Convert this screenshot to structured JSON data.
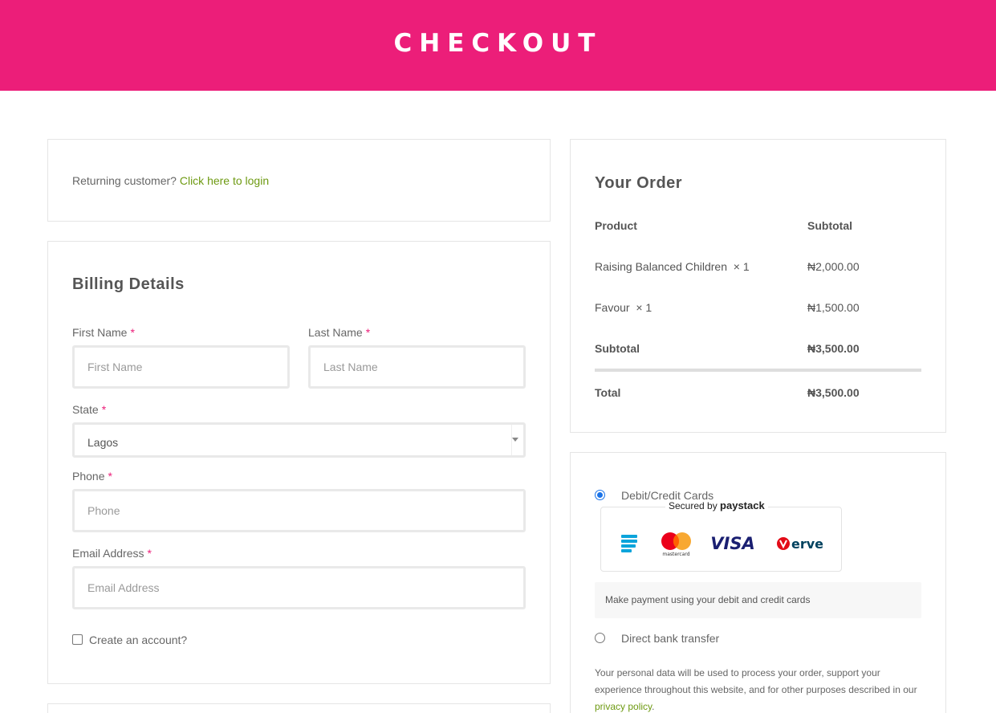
{
  "header": {
    "title": "CHECKOUT"
  },
  "login_notice": {
    "text": "Returning customer?",
    "link": "Click here to login"
  },
  "billing": {
    "heading": "Billing Details",
    "required_mark": "*",
    "first_name": {
      "label": "First Name",
      "placeholder": "First Name"
    },
    "last_name": {
      "label": "Last Name",
      "placeholder": "Last Name"
    },
    "state": {
      "label": "State",
      "value": "Lagos"
    },
    "phone": {
      "label": "Phone",
      "placeholder": "Phone"
    },
    "email": {
      "label": "Email Address",
      "placeholder": "Email Address"
    },
    "create_account": {
      "label": "Create an account?",
      "checked": false
    }
  },
  "order": {
    "heading": "Your Order",
    "col_product": "Product",
    "col_subtotal": "Subtotal",
    "items": [
      {
        "name": "Raising Balanced Children",
        "qty": "× 1",
        "price": "₦2,000.00"
      },
      {
        "name": "Favour",
        "qty": "× 1",
        "price": "₦1,500.00"
      }
    ],
    "subtotal_label": "Subtotal",
    "subtotal_value": "₦3,500.00",
    "total_label": "Total",
    "total_value": "₦3,500.00"
  },
  "payment": {
    "card_option": "Debit/Credit Cards",
    "secured_by": "Secured by",
    "provider": "paystack",
    "brands": [
      "mastercard",
      "VISA",
      "erve"
    ],
    "card_description": "Make payment using your debit and credit cards",
    "bank_option": "Direct bank transfer",
    "privacy_text": "Your personal data will be used to process your order, support your experience throughout this website, and for other purposes described in our",
    "privacy_link": "privacy policy",
    "privacy_end": "."
  },
  "colors": {
    "brand": "#ec1e79",
    "link": "#6e9a12",
    "radio": "#1a73e8"
  }
}
